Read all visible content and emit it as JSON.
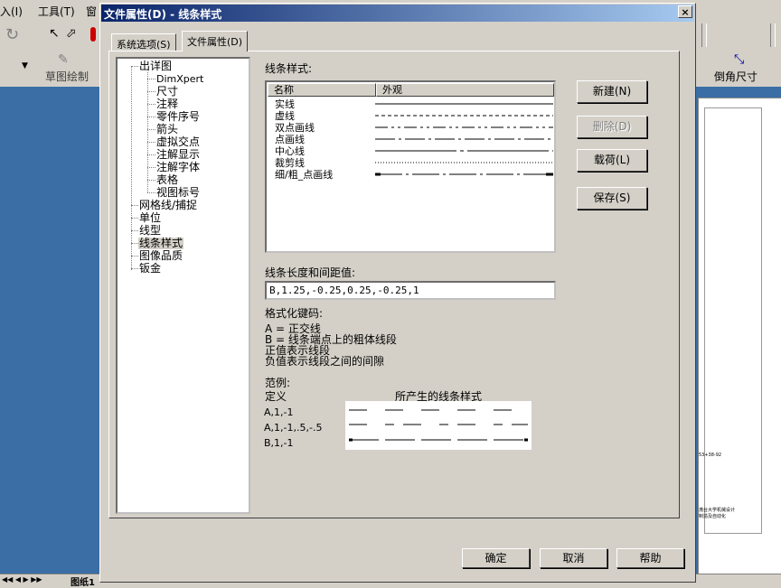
{
  "app": {
    "menu": [
      "入(I)",
      "工具(T)",
      "窗"
    ],
    "toolbar_label_1": "草图绘制",
    "toolbar_label_2": "倒角尺寸",
    "bottom_tab": "图纸1",
    "sheet_text_1": "53+38-92",
    "sheet_text_2": "渤台大学机械设计\n制造及自动化"
  },
  "dialog": {
    "title": "文件属性(D) - 线条样式",
    "close_label": "×",
    "tabs": [
      {
        "label": "系统选项(S)",
        "active": false
      },
      {
        "label": "文件属性(D)",
        "active": true
      }
    ],
    "tree": {
      "root": "出详图",
      "children": [
        "DimXpert",
        "尺寸",
        "注释",
        "零件序号",
        "箭头",
        "虚拟交点",
        "注解显示",
        "注解字体",
        "表格",
        "视图标号"
      ],
      "siblings": [
        "网格线/捕捉",
        "单位",
        "线型",
        "线条样式",
        "图像品质",
        "钣金"
      ],
      "selected": "线条样式"
    },
    "line_styles_label": "线条样式:",
    "columns": {
      "name": "名称",
      "appearance": "外观"
    },
    "line_styles": [
      "实线",
      "虚线",
      "双点画线",
      "点画线",
      "中心线",
      "裁剪线",
      "细/粗_点画线"
    ],
    "buttons": {
      "new": "新建(N)",
      "delete": "删除(D)",
      "load": "载荷(L)",
      "save": "保存(S)",
      "ok": "确定",
      "cancel": "取消",
      "help": "帮助"
    },
    "length_label": "线条长度和间距值:",
    "length_value": "B,1.25,-0.25,0.25,-0.25,1",
    "format_label": "格式化键码:",
    "format_lines": [
      "A = 正交线",
      "B = 线条端点上的粗体线段",
      "正值表示线段",
      "负值表示线段之间的间隙"
    ],
    "example_label": "范例:",
    "example_headers": {
      "definition": "定义",
      "result": "所产生的线条样式"
    },
    "examples": [
      "A,1,-1",
      "A,1,-1,.5,-.5",
      "B,1,-1"
    ]
  }
}
